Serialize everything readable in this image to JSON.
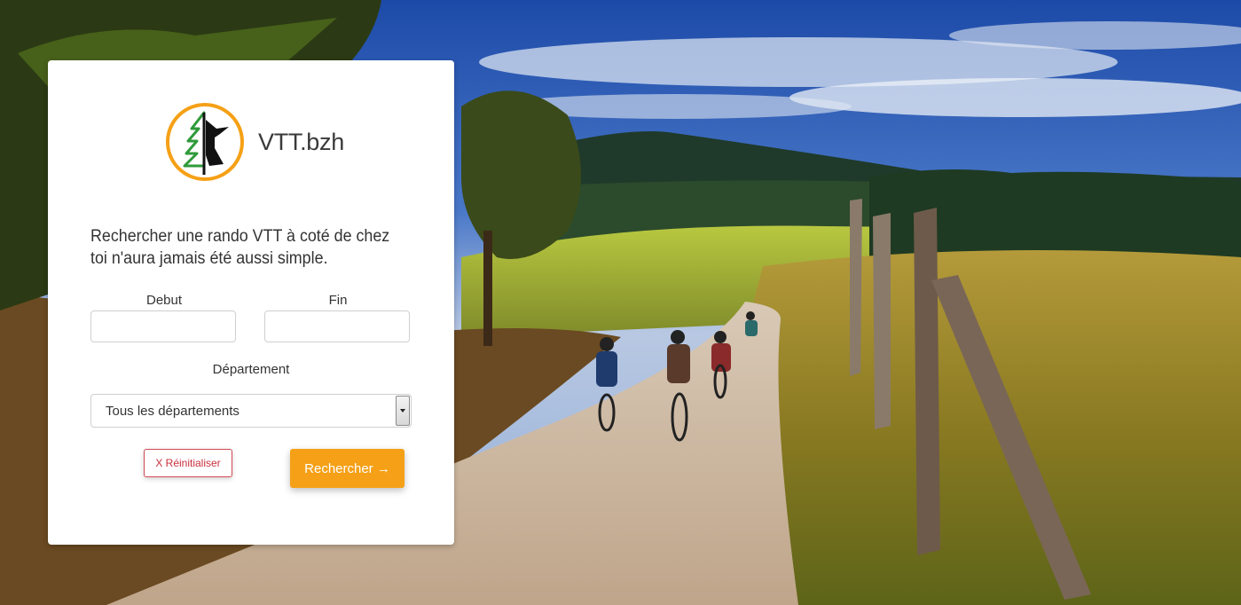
{
  "brand": {
    "name": "VTT.bzh",
    "logo_icon": "pine-tree-ermine-icon",
    "logo_ring_color": "#f5a016"
  },
  "tagline": "Rechercher une rando VTT à coté de chez toi n'aura jamais été aussi simple.",
  "form": {
    "start_label": "Debut",
    "start_value": "",
    "end_label": "Fin",
    "end_value": "",
    "department_label": "Département",
    "department_selected": "Tous les départements",
    "reset_label": "X Réinitialiser",
    "search_label": "Rechercher →"
  },
  "colors": {
    "accent": "#f5a016",
    "danger": "#c9303d"
  }
}
